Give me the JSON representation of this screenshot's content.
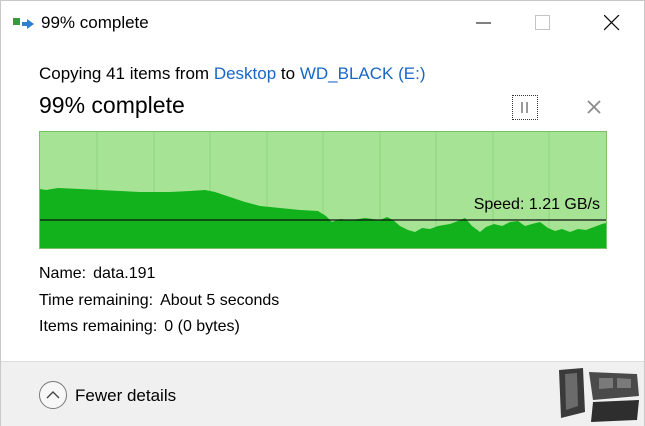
{
  "window": {
    "title": "99% complete"
  },
  "header": {
    "copy_prefix": "Copying 41 items from",
    "source": "Desktop",
    "connector": "to",
    "destination": "WD_BLACK (E:)",
    "percent_text": "99% complete"
  },
  "graph": {
    "speed_text": "Speed: 1.21 GB/s",
    "progress_fraction": 0.99,
    "fill_color": "#11b21b",
    "background_color": "#a6e394"
  },
  "details": {
    "name_label": "Name:",
    "name_value": "data.191",
    "time_label": "Time remaining:",
    "time_value": "About 5 seconds",
    "items_label": "Items remaining:",
    "items_value": "0 (0 bytes)"
  },
  "footer": {
    "toggle_label": "Fewer details"
  },
  "icons": {
    "app": "file-copy-icon",
    "minimize": "minimize-icon",
    "maximize": "maximize-icon",
    "close": "close-icon",
    "pause": "pause-icon",
    "cancel": "cancel-icon",
    "toggle": "chevron-up-icon"
  }
}
